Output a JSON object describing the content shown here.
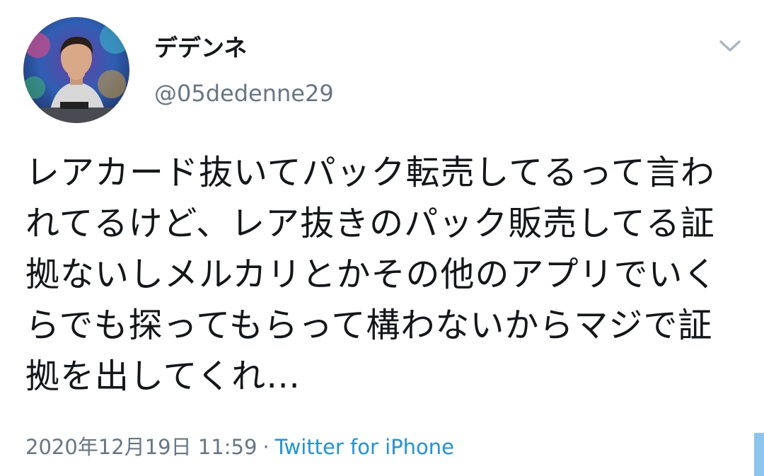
{
  "tweet": {
    "display_name": "デデンネ",
    "handle": "@05dedenne29",
    "text": "レアカード抜いてパック転売してるって言われてるけど、レア抜きのパック販売してる証拠ないしメルカリとかその他のアプリでいくらでも探ってもらって構わないからマジで証拠を出してくれ…",
    "timestamp": "2020年12月19日 11:59",
    "separator": "·",
    "source": "Twitter for iPhone"
  },
  "colors": {
    "text": "#14171a",
    "secondary": "#657786",
    "link": "#1b95e0",
    "chevron": "#aab8c2"
  },
  "icons": {
    "menu": "chevron-down-icon",
    "avatar": "profile-avatar"
  }
}
